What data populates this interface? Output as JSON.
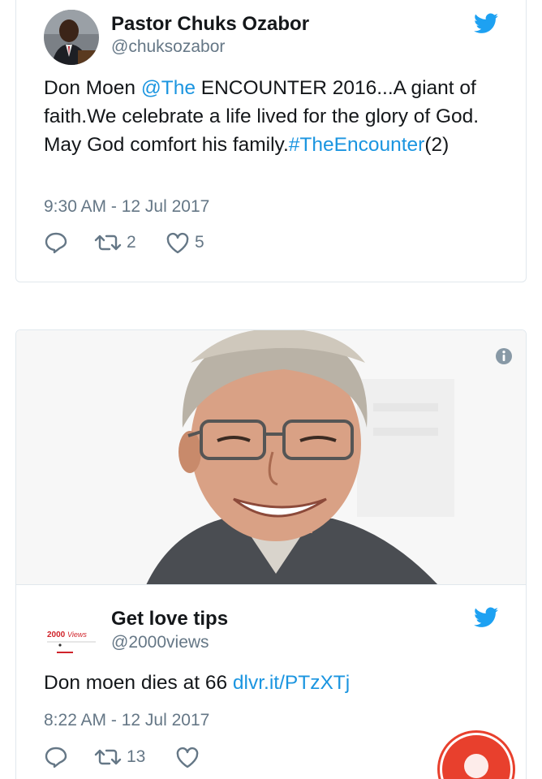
{
  "tweets": [
    {
      "author_name": "Pastor Chuks Ozabor",
      "handle": "@chuksozabor",
      "text_parts": [
        {
          "text": "Don Moen ",
          "link": false
        },
        {
          "text": "@The",
          "link": true
        },
        {
          "text": " ENCOUNTER 2016...A giant of faith.We celebrate a life lived for the glory of God. May God comfort his family.",
          "link": false
        },
        {
          "text": "#TheEncounter",
          "link": true
        },
        {
          "text": "(2)",
          "link": false
        }
      ],
      "timestamp": "9:30 AM - 12 Jul 2017",
      "retweets": "2",
      "likes": "5"
    },
    {
      "author_name": "Get love tips",
      "handle": "@2000views",
      "avatar_logo_text": "2000Views",
      "text_parts": [
        {
          "text": "Don moen dies at 66 ",
          "link": false
        },
        {
          "text": "dlvr.it/PTzXTj",
          "link": true
        }
      ],
      "timestamp": "8:22 AM - 12 Jul 2017",
      "retweets": "13",
      "likes": ""
    }
  ],
  "colors": {
    "twitter_blue": "#1da1f2",
    "link": "#1b95e0",
    "secondary_text": "#657786",
    "border": "#e1e8ed",
    "fab": "#e8402d"
  },
  "icons": [
    "twitter-bird-icon",
    "reply-icon",
    "retweet-icon",
    "like-icon",
    "info-icon",
    "profile-icon"
  ]
}
